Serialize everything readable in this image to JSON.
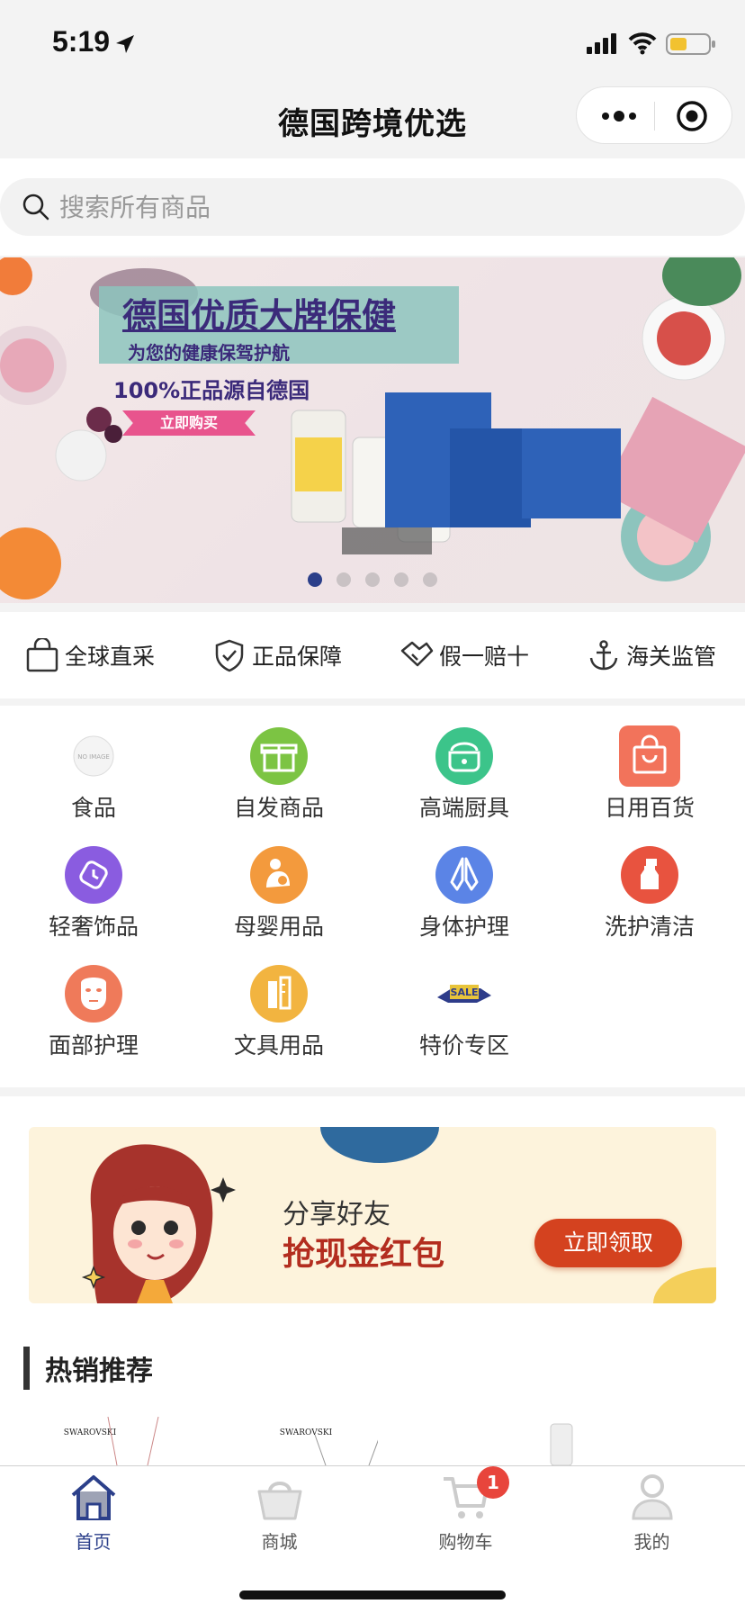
{
  "status_bar": {
    "time": "5:19",
    "icons": [
      "location-arrow-icon",
      "signal-icon",
      "wifi-icon",
      "battery-icon"
    ]
  },
  "nav": {
    "title": "德国跨境优选",
    "capsule_icons": [
      "more-icon",
      "close-target-icon"
    ]
  },
  "search": {
    "placeholder": "搜索所有商品"
  },
  "banner": {
    "title": "德国优质大牌保健",
    "subtitle": "为您的健康保驾护航",
    "tagline": "100%正品源自德国",
    "button": "立即购买",
    "slide_count": 5,
    "active_slide": 1
  },
  "features": [
    {
      "label": "全球直采",
      "icon": "shopping-bag-icon"
    },
    {
      "label": "正品保障",
      "icon": "shield-check-icon"
    },
    {
      "label": "假一赔十",
      "icon": "handshake-icon"
    },
    {
      "label": "海关监管",
      "icon": "anchor-icon"
    }
  ],
  "categories": [
    {
      "label": "食品",
      "icon": "no-image-icon",
      "color": "#dddddd"
    },
    {
      "label": "自发商品",
      "icon": "gift-icon",
      "color": "#7cc443"
    },
    {
      "label": "高端厨具",
      "icon": "rice-cooker-icon",
      "color": "#3cc48a"
    },
    {
      "label": "日用百货",
      "icon": "bag-icon",
      "color": "#f2735b"
    },
    {
      "label": "轻奢饰品",
      "icon": "watch-icon",
      "color": "#8a5ce0"
    },
    {
      "label": "母婴用品",
      "icon": "mother-baby-icon",
      "color": "#f39a3d"
    },
    {
      "label": "身体护理",
      "icon": "praying-hands-icon",
      "color": "#5b84e6"
    },
    {
      "label": "洗护清洁",
      "icon": "spray-bottle-icon",
      "color": "#e8533f"
    },
    {
      "label": "面部护理",
      "icon": "face-mask-icon",
      "color": "#ef7a5a"
    },
    {
      "label": "文具用品",
      "icon": "stationery-icon",
      "color": "#f2b440"
    },
    {
      "label": "特价专区",
      "icon": "special-offer-icon",
      "color": "#e8c43a"
    }
  ],
  "promo": {
    "subtitle": "分享好友",
    "title": "抢现金红包",
    "button": "立即领取"
  },
  "hot": {
    "title": "热销推荐",
    "brand": "SWAROVSKI"
  },
  "tabs": [
    {
      "label": "首页",
      "icon": "home-icon",
      "active": true
    },
    {
      "label": "商城",
      "icon": "shopping-basket-icon",
      "active": false
    },
    {
      "label": "购物车",
      "icon": "cart-icon",
      "active": false,
      "badge": "1"
    },
    {
      "label": "我的",
      "icon": "user-icon",
      "active": false
    }
  ],
  "colors": {
    "accent": "#2b3f8a",
    "promo_button": "#d4421f",
    "badge": "#e8453c"
  }
}
